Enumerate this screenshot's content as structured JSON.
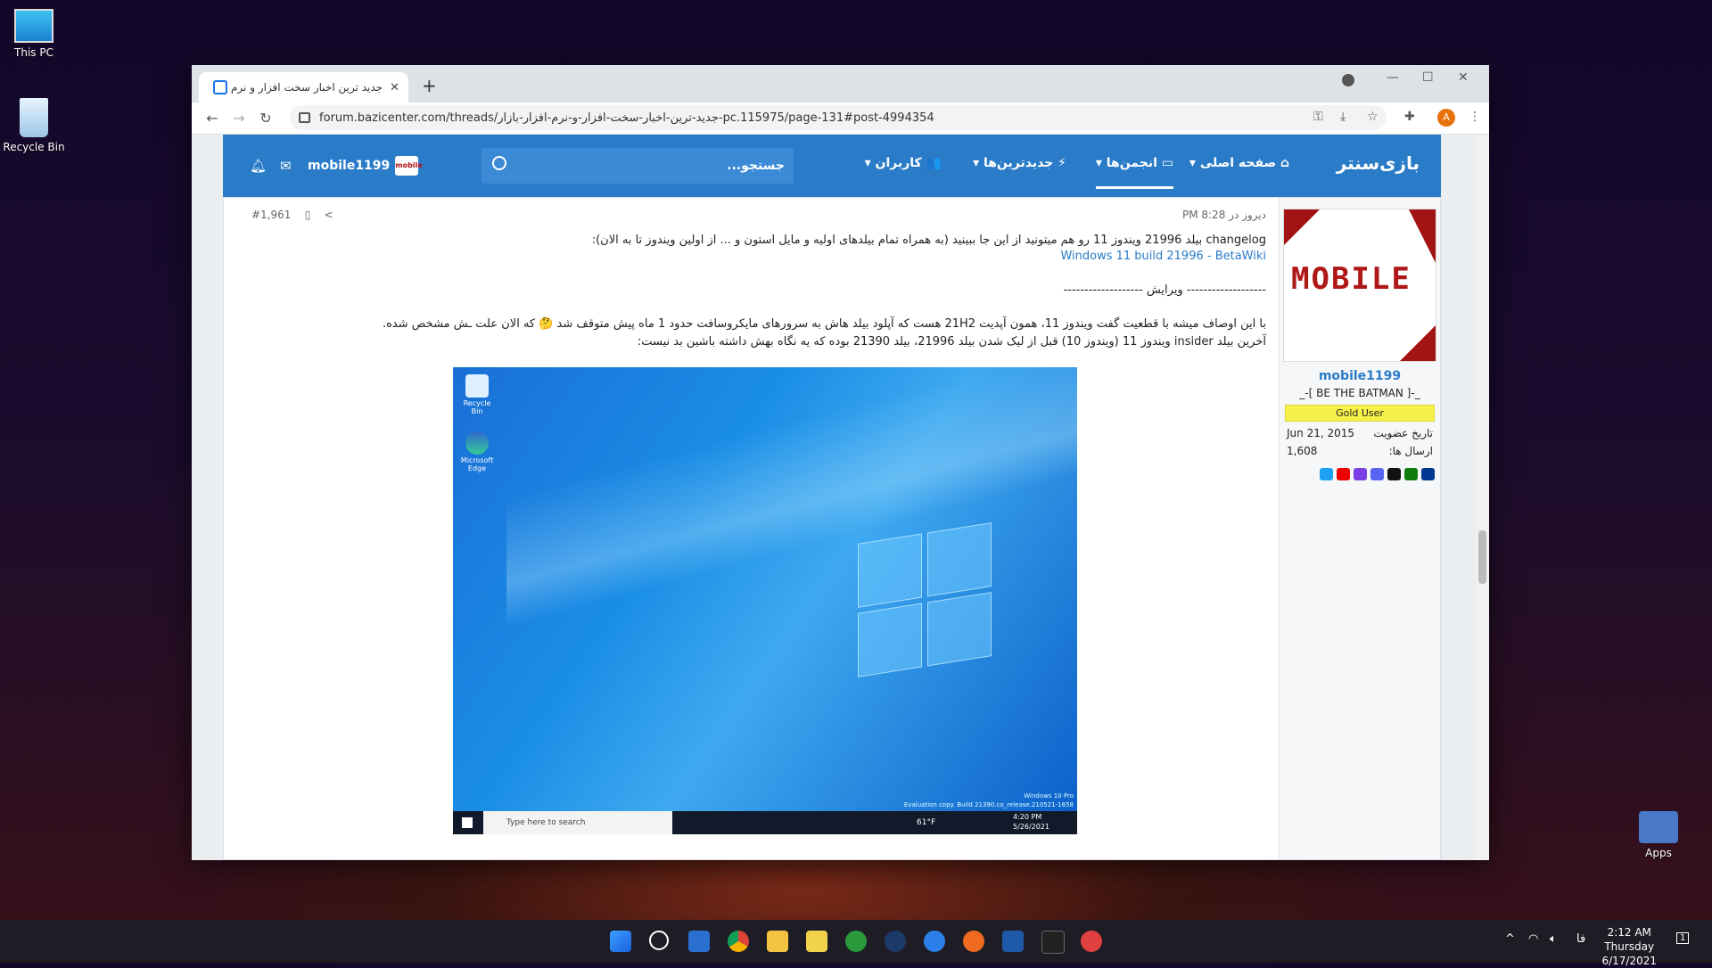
{
  "desktop": {
    "icons": [
      {
        "label": "This PC"
      },
      {
        "label": "Recycle Bin"
      },
      {
        "label": "Apps"
      }
    ]
  },
  "browser": {
    "tab_title": "جدید ترین اخبار سخت افزار و نرم افزار",
    "url": "forum.bazicenter.com/threads/جدید-ترین-اخبار-سخت-افزار-و-نرم-افزار-بازار-pc.115975/page-131#post-4994354",
    "profile_initial": "A"
  },
  "site": {
    "logo": "بازی‌سنتر",
    "nav": {
      "home": "صفحه اصلی",
      "forums": "انجمن‌ها",
      "newest": "جدیدترین‌ها",
      "members": "کاربران"
    },
    "search_placeholder": "جستجو...",
    "username": "mobile1199"
  },
  "post": {
    "time": "دیروز در 8:28 PM",
    "number": "#1,961",
    "line1": "changelog بیلد 21996 ویندوز 11 رو هم میتونید از این جا ببینید (به همراه تمام بیلدهای اولیه و مایل استون و ... از اولین ویندوز تا به الان):",
    "link": "Windows 11 build 21996 - BetaWiki",
    "edit_sep": "------------------- ویرایش -------------------",
    "line2": "با این اوصاف میشه با قطعیت گفت ویندوز 11، همون آپدیت 21H2 هست که آپلود بیلد هاش به سرورهای مایکروسافت حدود 1 ماه پیش متوقف شد 🤔 که الان علت ـش مشخص شده.",
    "line3": "آخرین بیلد insider ویندوز 11 (ویندوز 10) قبل از لیک شدن بیلد 21996، بیلد 21390 بوده که یه نگاه بهش داشته باشین بد نیست:"
  },
  "user": {
    "name": "mobile1199",
    "title": "_-[ BE THE BATMAN ]-_",
    "badge": "Gold User",
    "joined_label": "تاریخ عضویت",
    "joined": "Jun 21, 2015",
    "posts_label": "ارسال ها:",
    "posts": "1,608"
  },
  "screenshot": {
    "recycle": "Recycle Bin",
    "edge": "Microsoft Edge",
    "watermark1": "Windows 10 Pro",
    "watermark2": "Evaluation copy. Build 21390.co_release.210521-1658",
    "search": "Type here to search",
    "weather": "61°F",
    "time": "4:20 PM",
    "date": "5/26/2021"
  },
  "taskbar": {
    "time": "2:12 AM",
    "day": "Thursday",
    "date": "6/17/2021",
    "lang": "فا",
    "notif": "1"
  },
  "colors": {
    "accent": "#2a7bc8",
    "badge": "#f6f04b"
  }
}
